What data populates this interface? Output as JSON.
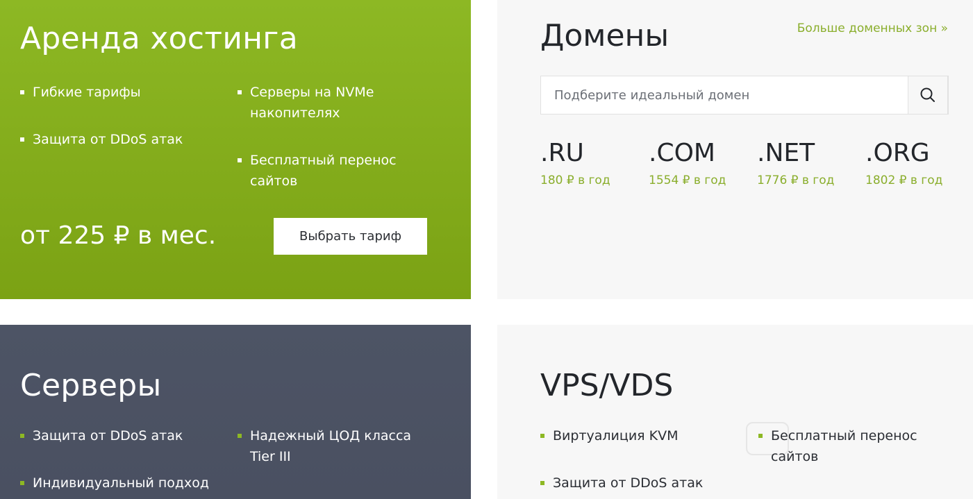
{
  "hosting": {
    "title": "Аренда хостинга",
    "features_left": [
      "Гибкие тарифы",
      "Защита от DDoS атак"
    ],
    "features_right": [
      "Серверы на NVMe накопителях",
      "Бесплатный перенос сайтов"
    ],
    "price": "от 225 ₽ в мес.",
    "button_label": "Выбрать тариф"
  },
  "domains": {
    "title": "Домены",
    "more_link": "Больше доменных зон »",
    "search_placeholder": "Подберите идеальный домен",
    "zones": [
      {
        "name": ".RU",
        "price": "180 ₽ в год"
      },
      {
        "name": ".COM",
        "price": "1554 ₽ в год"
      },
      {
        "name": ".NET",
        "price": "1776 ₽ в год"
      },
      {
        "name": ".ORG",
        "price": "1802 ₽ в год"
      }
    ]
  },
  "servers": {
    "title": "Серверы",
    "features_left": [
      "Защита от DDoS атак",
      "Индивидуальный подход"
    ],
    "features_right": [
      "Надежный ЦОД класса Tier III"
    ]
  },
  "vps": {
    "title": "VPS/VDS",
    "features_left": [
      "Виртуалиция KVM",
      "Защита от DDoS атак"
    ],
    "features_right": [
      "Бесплатный перенос сайтов"
    ]
  },
  "colors": {
    "accent_green": "#8db824",
    "link_green": "#8aae2c",
    "slate": "#4d5465",
    "light_bg": "#f7f7f7"
  }
}
